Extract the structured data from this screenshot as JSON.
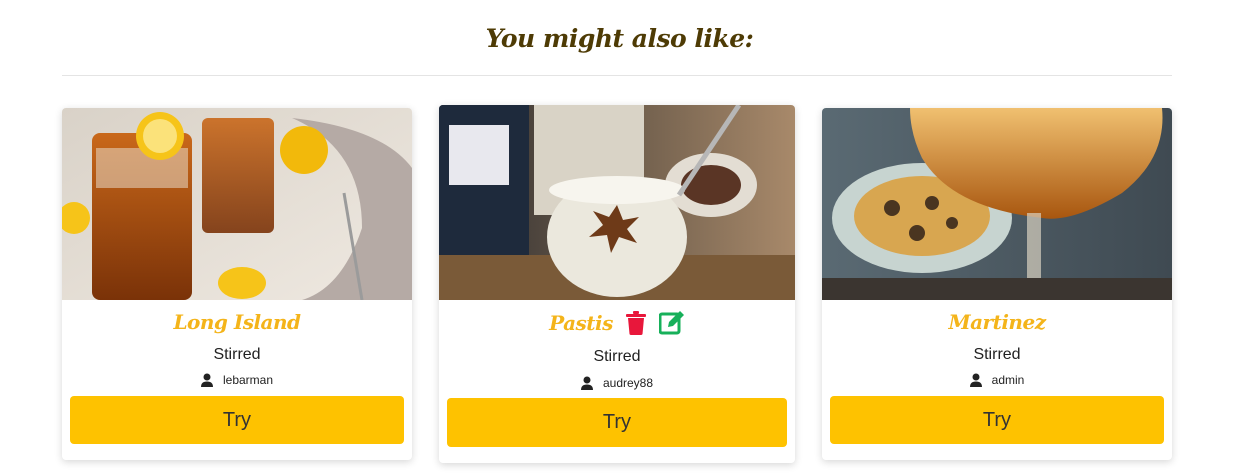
{
  "section": {
    "title": "You might also like:"
  },
  "cards": [
    {
      "name": "Long Island",
      "method": "Stirred",
      "author": "lebarman",
      "try_label": "Try",
      "image_icon": "long-island-cocktail-photo"
    },
    {
      "name": "Pastis",
      "method": "Stirred",
      "author": "audrey88",
      "try_label": "Try",
      "image_icon": "pastis-cocktail-photo",
      "owner_actions": {
        "delete_icon": "trash-icon",
        "edit_icon": "edit-icon"
      }
    },
    {
      "name": "Martinez",
      "method": "Stirred",
      "author": "admin",
      "try_label": "Try",
      "image_icon": "martinez-cocktail-photo"
    }
  ],
  "colors": {
    "title": "#4e3b05",
    "card_title": "#f4b41a",
    "try_button": "#fec200",
    "delete": "#e8173b",
    "edit": "#17b05a"
  }
}
